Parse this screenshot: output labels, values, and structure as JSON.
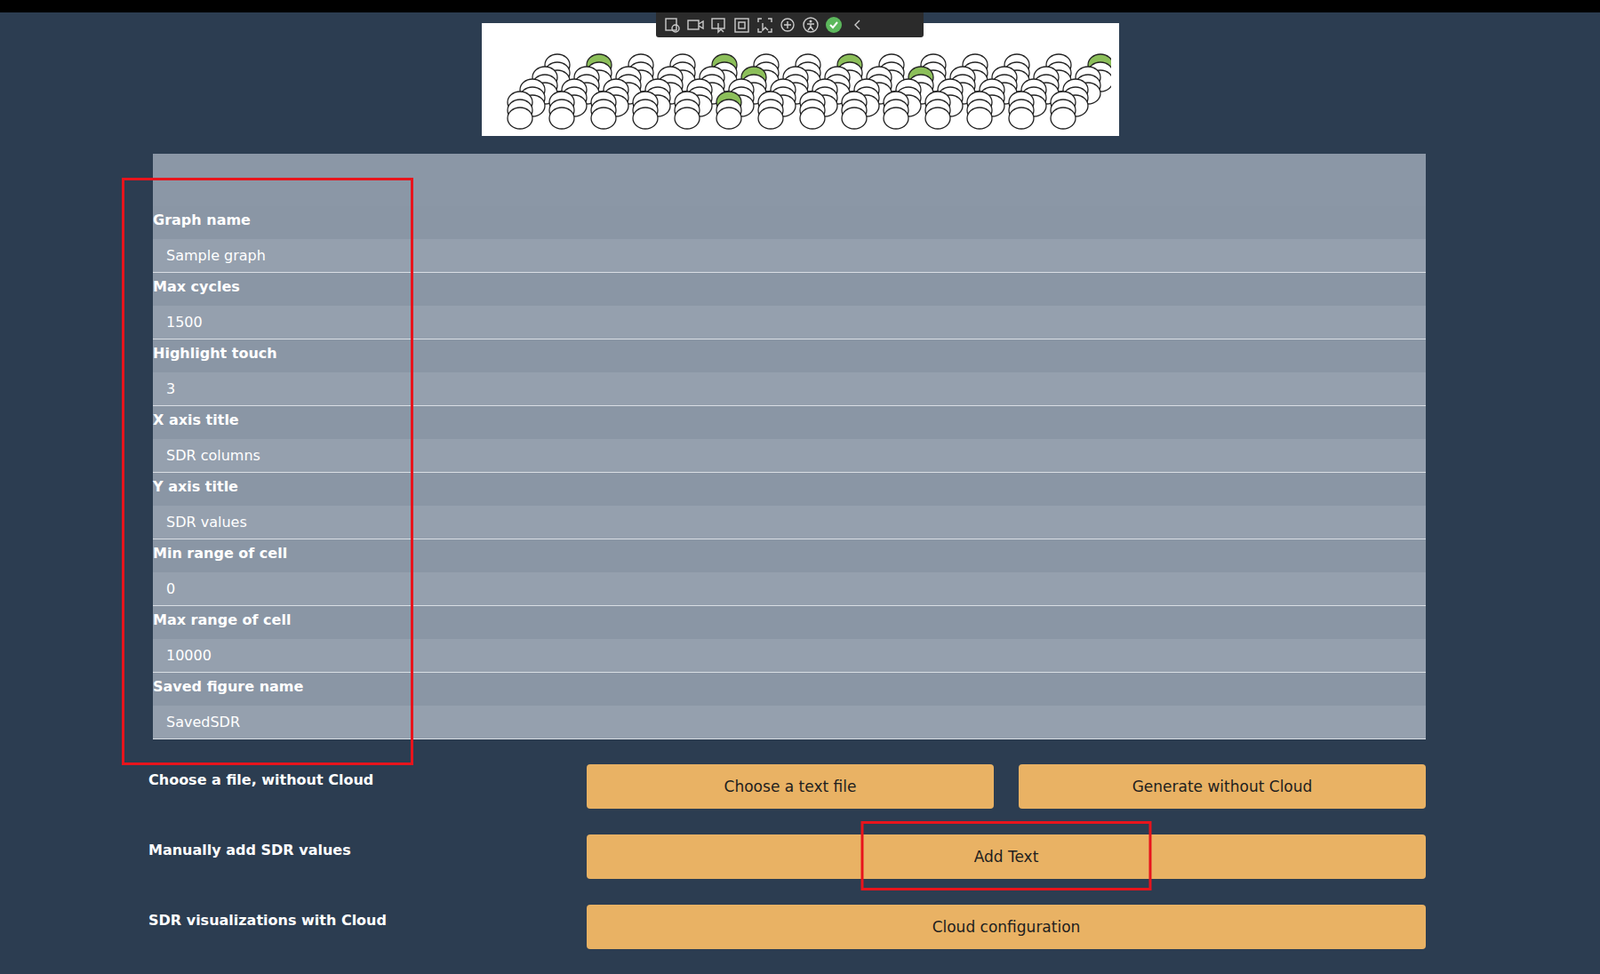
{
  "form": {
    "highlighted": true,
    "fields": [
      {
        "label": "Graph name",
        "value": "Sample graph"
      },
      {
        "label": "Max cycles",
        "value": "1500"
      },
      {
        "label": "Highlight touch",
        "value": "3"
      },
      {
        "label": "X axis title",
        "value": "SDR columns"
      },
      {
        "label": "Y axis title",
        "value": "SDR values"
      },
      {
        "label": "Min range of cell",
        "value": "0"
      },
      {
        "label": "Max range of cell",
        "value": "10000"
      },
      {
        "label": "Saved figure name",
        "value": "SavedSDR"
      }
    ]
  },
  "actions": [
    {
      "label": "Choose a file, without Cloud",
      "buttons": [
        {
          "label": "Choose a text file",
          "highlighted": false
        },
        {
          "label": "Generate without Cloud",
          "highlighted": false
        }
      ]
    },
    {
      "label": "Manually add SDR values",
      "buttons": [
        {
          "label": "Add Text",
          "highlighted": true
        }
      ]
    },
    {
      "label": "SDR visualizations with Cloud",
      "buttons": [
        {
          "label": "Cloud configuration",
          "highlighted": false
        }
      ]
    }
  ]
}
